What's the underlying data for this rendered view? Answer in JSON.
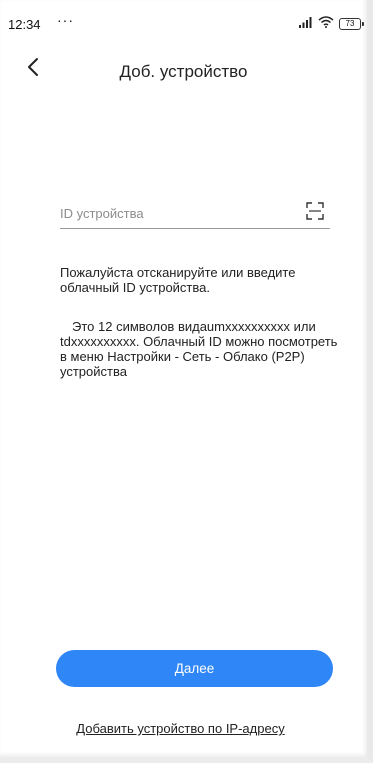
{
  "status_bar": {
    "time": "12:34",
    "dots": "···",
    "battery_level": "73",
    "icons": [
      "signal-icon",
      "wifi-icon",
      "battery-icon"
    ]
  },
  "header": {
    "title": "Доб. устройство",
    "back_icon": "back-arrow-icon"
  },
  "device_id": {
    "placeholder": "ID устройства",
    "value": "",
    "scan_icon": "scan-icon"
  },
  "hints": {
    "primary": "Пожалуйста отсканируйте или введите облачный ID устройства.",
    "secondary": "Это 12 символов видаumxxxxxxxxxx или tdxxxxxxxxxx. Облачный ID можно посмотреть в меню Настройки - Сеть - Облако (P2P) устройства"
  },
  "actions": {
    "next_label": "Далее",
    "add_by_ip_label": "Добавить устройство по IP-адресу"
  },
  "colors": {
    "accent": "#2f86f6",
    "text": "#222222",
    "placeholder": "#8c8c8c",
    "divider": "#9a9a9a"
  }
}
